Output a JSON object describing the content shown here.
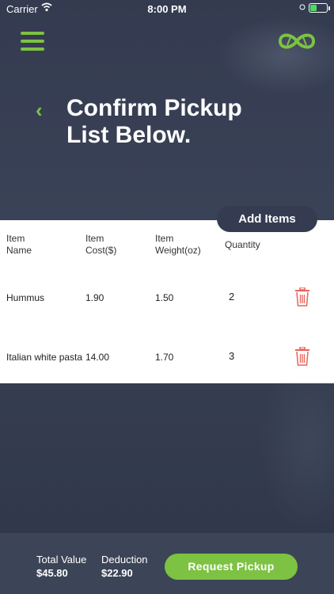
{
  "status_bar": {
    "carrier": "Carrier",
    "time": "8:00 PM"
  },
  "header": {
    "title_line1": "Confirm Pickup",
    "title_line2": "List Below."
  },
  "actions": {
    "add_items": "Add Items",
    "request_pickup": "Request Pickup"
  },
  "table": {
    "headers": {
      "name_1": "Item",
      "name_2": "Name",
      "cost_1": "Item",
      "cost_2": "Cost($)",
      "weight_1": "Item",
      "weight_2": "Weight(oz)",
      "quantity": "Quantity"
    },
    "rows": [
      {
        "name": "Hummus",
        "cost": "1.90",
        "weight": "1.50",
        "quantity": "2"
      },
      {
        "name": "Italian white pasta",
        "cost": "14.00",
        "weight": "1.70",
        "quantity": "3"
      }
    ]
  },
  "footer": {
    "total_label": "Total Value",
    "total_value": "$45.80",
    "deduction_label": "Deduction",
    "deduction_value": "$22.90"
  },
  "colors": {
    "accent": "#7dc242",
    "dark": "#353c51",
    "delete": "#e8645a"
  },
  "icons": [
    "wifi-icon",
    "battery-icon",
    "menu-icon",
    "logo-icon",
    "back-chevron-icon",
    "trash-icon"
  ]
}
